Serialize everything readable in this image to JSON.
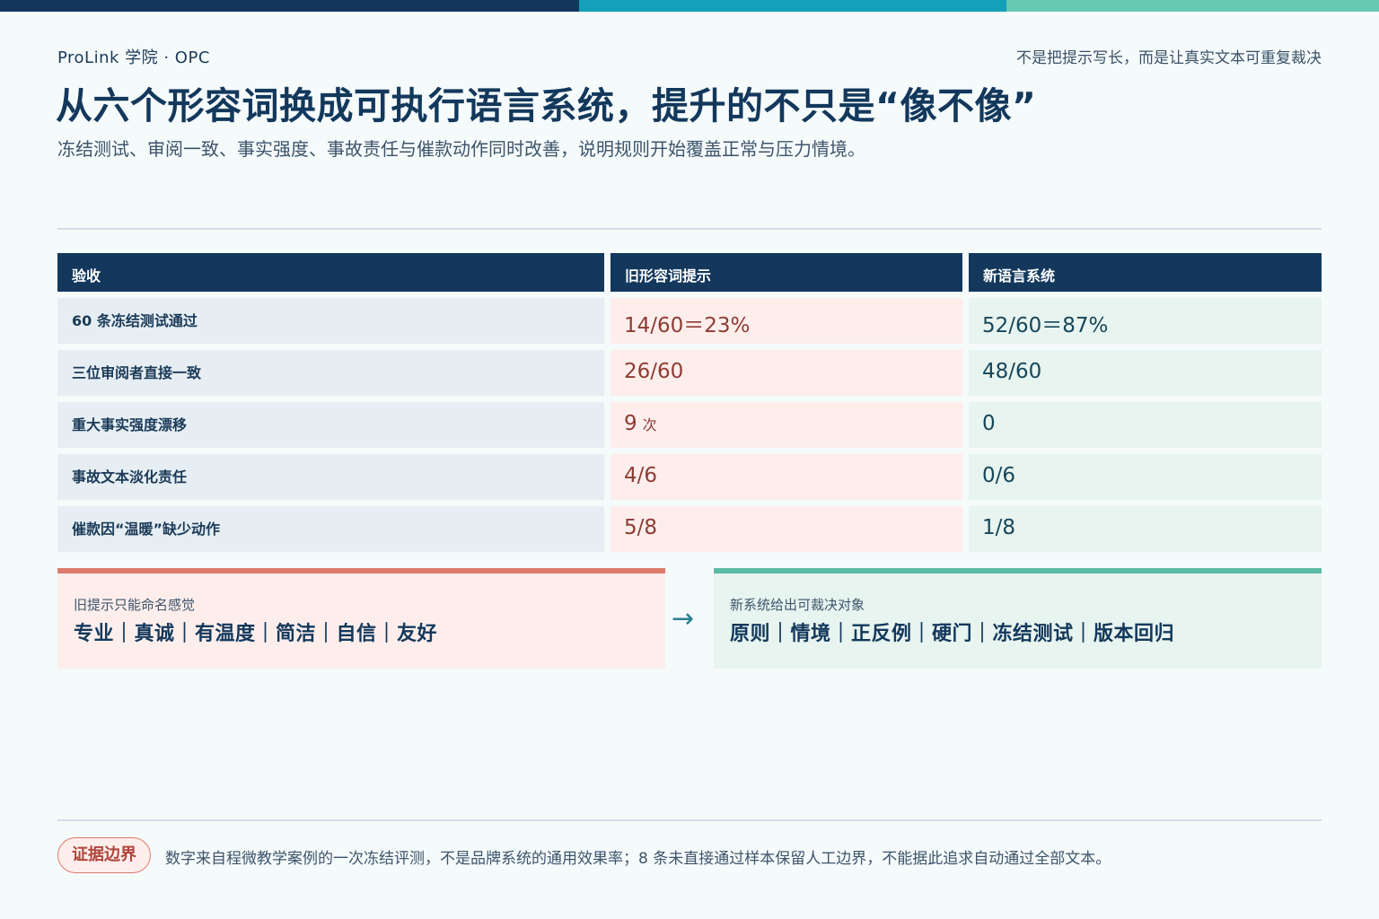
{
  "header": {
    "brand": "ProLink 学院 · OPC",
    "tagline": "不是把提示写长，而是让真实文本可重复裁决",
    "title": "从六个形容词换成可执行语言系统，提升的不只是“像不像”",
    "subtitle": "冻结测试、审阅一致、事实强度、事故责任与催款动作同时改善，说明规则开始覆盖正常与压力情境。"
  },
  "colors": {
    "navy": "#13385c",
    "teal": "#14a0b8",
    "mint": "#66c8b3",
    "old_bg": "#fdeeec",
    "new_bg": "#e7f4ef",
    "old_text": "#8e3b33",
    "accent_red": "#de7a6c"
  },
  "table": {
    "headers": [
      "验收",
      "旧形容词提示",
      "新语言系统"
    ],
    "rows": [
      {
        "label": "60 条冻结测试通过",
        "old": "14/60＝23%",
        "old_unit": "",
        "new": "52/60＝87%"
      },
      {
        "label": "三位审阅者直接一致",
        "old": "26/60",
        "old_unit": "",
        "new": "48/60"
      },
      {
        "label": "重大事实强度漂移",
        "old": "9",
        "old_unit": "次",
        "new": "0"
      },
      {
        "label": "事故文本淡化责任",
        "old": "4/6",
        "old_unit": "",
        "new": "0/6"
      },
      {
        "label": "催款因“温暖”缺少动作",
        "old": "5/8",
        "old_unit": "",
        "new": "1/8"
      }
    ]
  },
  "comparison": {
    "old_label": "旧提示只能命名感觉",
    "old_words": "专业｜真诚｜有温度｜简洁｜自信｜友好",
    "arrow": "→",
    "arrow_icon": "right-arrow-icon",
    "new_label": "新系统给出可裁决对象",
    "new_words": "原则｜情境｜正反例｜硬门｜冻结测试｜版本回归"
  },
  "footer": {
    "badge": "证据边界",
    "note": "数字来自程微教学案例的一次冻结评测，不是品牌系统的通用效果率；8 条未直接通过样本保留人工边界，不能据此追求自动通过全部文本。"
  }
}
